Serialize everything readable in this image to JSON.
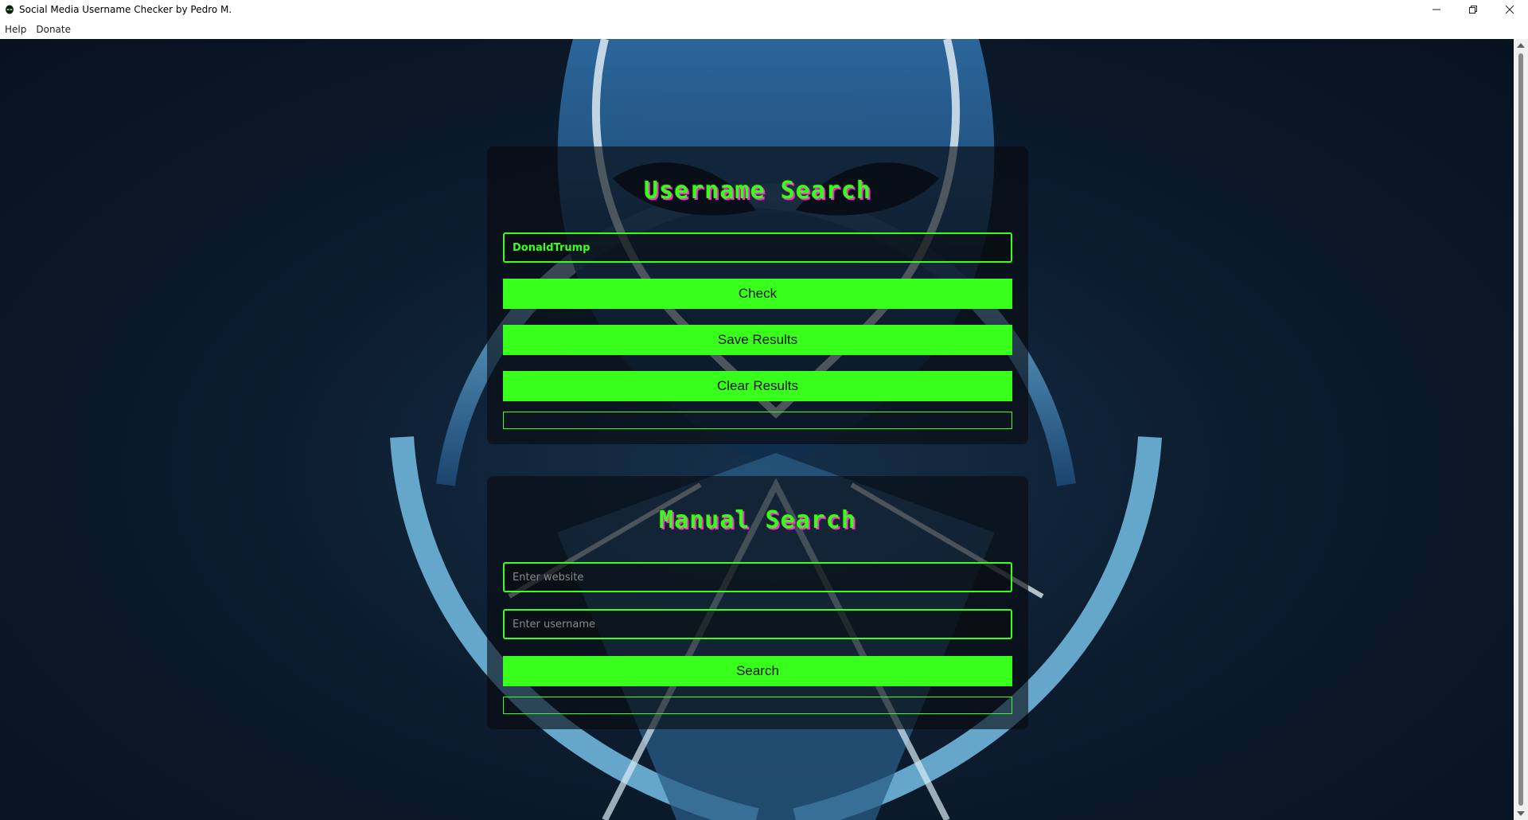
{
  "window": {
    "title": "Social Media Username Checker by Pedro M.",
    "icon": "alien-icon"
  },
  "menu": {
    "items": [
      {
        "label": "Help"
      },
      {
        "label": "Donate"
      }
    ]
  },
  "colors": {
    "accent": "#38ff1c",
    "heading_shadow": "#ff2dd1",
    "background": "#0c1c2e"
  },
  "username_search": {
    "heading": "Username Search",
    "input_value": "DonaldTrump",
    "check_label": "Check",
    "save_label": "Save Results",
    "clear_label": "Clear Results",
    "result_text": ""
  },
  "manual_search": {
    "heading": "Manual Search",
    "website_placeholder": "Enter website",
    "username_placeholder": "Enter username",
    "search_label": "Search",
    "result_text": ""
  }
}
